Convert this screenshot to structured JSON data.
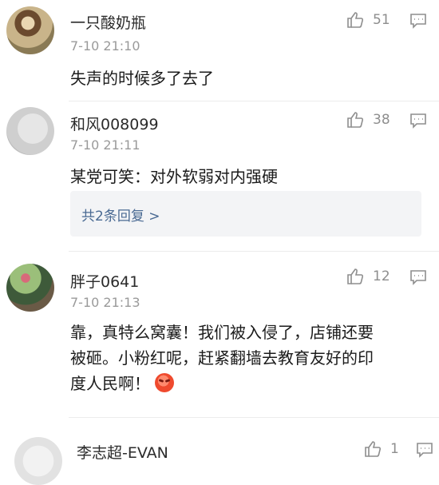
{
  "comments": [
    {
      "user": "一只酸奶瓶",
      "time": "7-10 21:10",
      "likes": "51",
      "text": "失声的时候多了去了",
      "avatar_icon": "user-photo-icon"
    },
    {
      "user": "和风008099",
      "time": "7-10 21:11",
      "likes": "38",
      "text": "某党可笑：对外软弱对内强硬",
      "replies_label": "共2条回复 >",
      "avatar_icon": "user-photo-icon"
    },
    {
      "user": "胖子0641",
      "time": "7-10 21:13",
      "likes": "12",
      "text_line1": "靠，真特么窝囊！我们被入侵了，店铺还要",
      "text_line2": "被砸。小粉红呢，赶紧翻墙去教育友好的印",
      "text_line3": "度人民啊！",
      "emoji": "angry-face-emoji",
      "avatar_icon": "user-photo-icon"
    },
    {
      "user": "李志超-EVAN",
      "likes": "1",
      "avatar_icon": "user-photo-icon"
    }
  ],
  "icons": {
    "like": "thumbs-up-icon",
    "reply": "comment-icon"
  },
  "colors": {
    "meta_gray": "#9a9a9a",
    "link_blue": "#4a6a93",
    "reply_bg": "#f3f4f6"
  }
}
